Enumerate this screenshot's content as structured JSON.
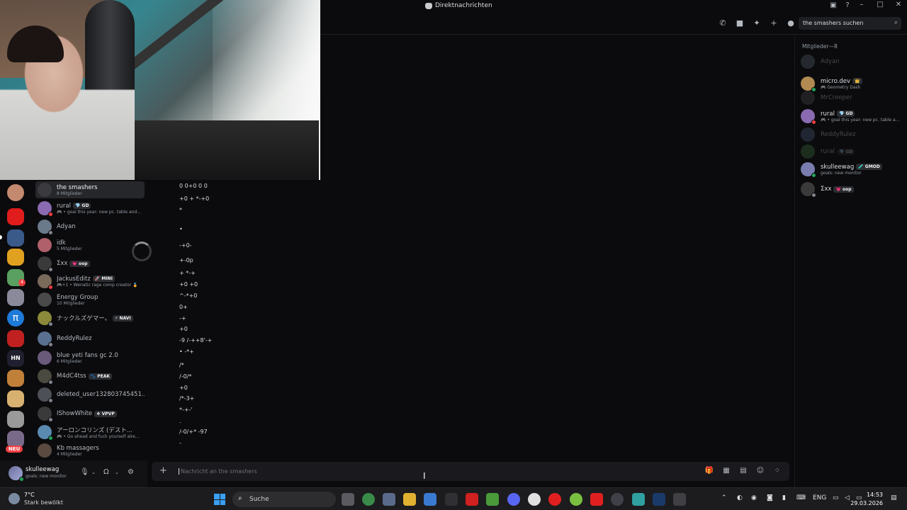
{
  "titlebar": {
    "title": "Direktnachrichten"
  },
  "header": {
    "search_placeholder": "the smashers suchen"
  },
  "dms": [
    {
      "name": "the smashers",
      "sub": "8 Mitglieder",
      "active": true,
      "color": "#3b3b3f",
      "tag": ""
    },
    {
      "name": "rural",
      "sub": "🎮 • goal this year: new pc. table and...",
      "tag": "💎 GD",
      "color": "#8a6ab0",
      "status": "#f23f43"
    },
    {
      "name": "Adyan",
      "sub": "",
      "tag": "",
      "color": "#6a7a8a",
      "status": "#80848e"
    },
    {
      "name": "idk",
      "sub": "5 Mitglieder",
      "tag": "",
      "color": "#b0606a"
    },
    {
      "name": "Σxx",
      "sub": "",
      "tag": "💗 oop",
      "color": "#3a3a3a",
      "status": "#80848e"
    },
    {
      "name": "JackusEditz",
      "sub": "🎮+1 • Wenatic rage comp creator 🏅",
      "tag": "🚀 MINI",
      "color": "#7a6a5a",
      "status": "#f23f43"
    },
    {
      "name": "Energy Group",
      "sub": "10 Mitglieder",
      "tag": "",
      "color": "#4a4a4a"
    },
    {
      "name": "ナックルズゲマー。",
      "sub": "",
      "tag": "⚡ NAVI",
      "color": "#8a8a3a",
      "status": "#80848e"
    },
    {
      "name": "ReddyRulez",
      "sub": "",
      "tag": "",
      "color": "#5a7090",
      "status": "#80848e"
    },
    {
      "name": "blue yeti fans gc 2.0",
      "sub": "6 Mitglieder",
      "tag": "",
      "color": "#6a5a7a"
    },
    {
      "name": "M4dC4tss",
      "sub": "",
      "tag": "🐾 PEAK",
      "color": "#4a4a40",
      "status": "#80848e"
    },
    {
      "name": "deleted_user132803745451...",
      "sub": "",
      "tag": "",
      "color": "#4e5058",
      "status": "#80848e"
    },
    {
      "name": "IShowWhite",
      "sub": "",
      "tag": "❖ VPVP",
      "color": "#3a3a3a",
      "status": "#80848e"
    },
    {
      "name": "アーロンコリンズ (デスト...",
      "sub": "🎮 • Go ahead and fuck yourself alrea...",
      "tag": "",
      "color": "#5a8ab0",
      "status": "#23a55a"
    },
    {
      "name": "Kb massagers",
      "sub": "4 Mitglieder",
      "tag": "",
      "color": "#5a4a40"
    }
  ],
  "rail": {
    "new_badge": "NEU"
  },
  "user": {
    "name": "skulleewag",
    "status": "goals: new monitor"
  },
  "messages": {
    "lines": [
      "0    0+0  0  0",
      "+0 + *-+0",
      "*",
      "•",
      "   -+0-",
      "   +-0p",
      "+    *-+",
      "+0   +0",
      "^-*+0",
      "0+",
      "-+",
      "+0",
      "-9   /-++8'-+",
      "•   -*+",
      "/*",
      "/-0/*",
      "+0",
      "/*-3+",
      "*-+-'",
      ".",
      "/-0/+* -97",
      "-"
    ],
    "composer_placeholder": "Nachricht an the smashers"
  },
  "members": {
    "heading": "Mitglieder—8",
    "list": [
      {
        "name": "Adyan",
        "sub": "",
        "tag": "",
        "offline": true,
        "color": "#6a7a8a"
      },
      {
        "name": "micro.dev",
        "sub": "🎮 Geometry Dash",
        "tag": "👑",
        "offline": false,
        "color": "#b08a50",
        "status": "#23a55a"
      },
      {
        "name": "MrCreeper",
        "sub": "",
        "tag": "",
        "offline": true,
        "color": "#5a5a5a"
      },
      {
        "name": "rural",
        "sub": "🎮 • goal this year: new pc. table a...",
        "tag": "💎 GD",
        "offline": false,
        "color": "#8a6ab0",
        "status": "#f23f43"
      },
      {
        "name": "ReddyRulez",
        "sub": "",
        "tag": "",
        "offline": true,
        "color": "#5a7090"
      },
      {
        "name": "rural",
        "sub": "",
        "tag": "💎 GD",
        "offline": true,
        "color": "#4a8a4a"
      },
      {
        "name": "skulleewag",
        "sub": "goals: new monitor",
        "tag": "🧪 GMOD",
        "offline": false,
        "color": "#7a7db0",
        "status": "#23a55a"
      },
      {
        "name": "Σxx",
        "sub": "",
        "tag": "💗 oop",
        "offline": false,
        "color": "#3a3a3a",
        "status": "#80848e"
      }
    ]
  },
  "taskbar": {
    "temp": "7°C",
    "weather": "Stark bewölkt",
    "search_label": "Suche",
    "lang": "ENG",
    "time": "14:53",
    "date": "29.03.2026"
  }
}
